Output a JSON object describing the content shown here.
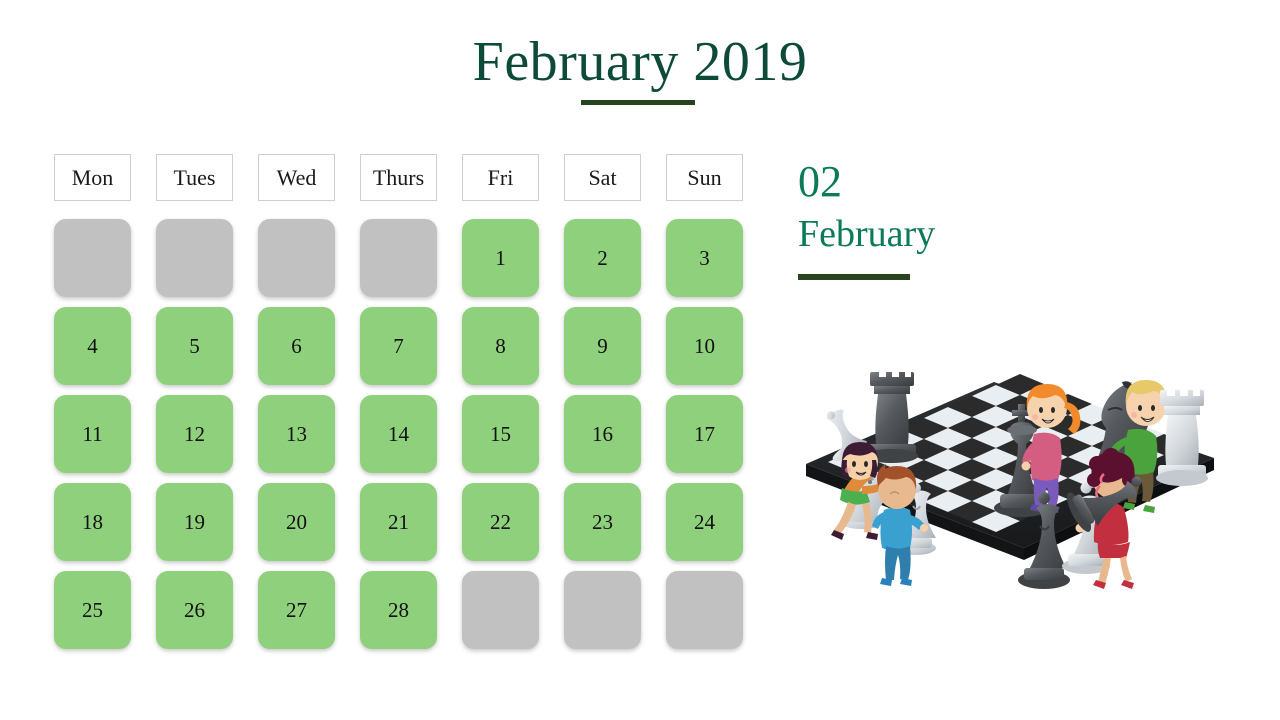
{
  "header": {
    "title": "February 2019",
    "accent_color": "#0d4a3a",
    "underline_color": "#28441f"
  },
  "calendar": {
    "weekdays": [
      "Mon",
      "Tues",
      "Wed",
      "Thurs",
      "Fri",
      "Sat",
      "Sun"
    ],
    "filled_color": "#8fd07c",
    "empty_color": "#c1c1c1",
    "weeks": [
      [
        {
          "label": "",
          "state": "empty"
        },
        {
          "label": "",
          "state": "empty"
        },
        {
          "label": "",
          "state": "empty"
        },
        {
          "label": "",
          "state": "empty"
        },
        {
          "label": "1",
          "state": "filled"
        },
        {
          "label": "2",
          "state": "filled"
        },
        {
          "label": "3",
          "state": "filled"
        }
      ],
      [
        {
          "label": "4",
          "state": "filled"
        },
        {
          "label": "5",
          "state": "filled"
        },
        {
          "label": "6",
          "state": "filled"
        },
        {
          "label": "7",
          "state": "filled"
        },
        {
          "label": "8",
          "state": "filled"
        },
        {
          "label": "9",
          "state": "filled"
        },
        {
          "label": "10",
          "state": "filled"
        }
      ],
      [
        {
          "label": "11",
          "state": "filled"
        },
        {
          "label": "12",
          "state": "filled"
        },
        {
          "label": "13",
          "state": "filled"
        },
        {
          "label": "14",
          "state": "filled"
        },
        {
          "label": "15",
          "state": "filled"
        },
        {
          "label": "16",
          "state": "filled"
        },
        {
          "label": "17",
          "state": "filled"
        }
      ],
      [
        {
          "label": "18",
          "state": "filled"
        },
        {
          "label": "19",
          "state": "filled"
        },
        {
          "label": "20",
          "state": "filled"
        },
        {
          "label": "21",
          "state": "filled"
        },
        {
          "label": "22",
          "state": "filled"
        },
        {
          "label": "23",
          "state": "filled"
        },
        {
          "label": "24",
          "state": "filled"
        }
      ],
      [
        {
          "label": "25",
          "state": "filled"
        },
        {
          "label": "26",
          "state": "filled"
        },
        {
          "label": "27",
          "state": "filled"
        },
        {
          "label": "28",
          "state": "filled"
        },
        {
          "label": "",
          "state": "empty"
        },
        {
          "label": "",
          "state": "empty"
        },
        {
          "label": "",
          "state": "empty"
        }
      ]
    ]
  },
  "side_panel": {
    "month_number": "02",
    "month_name": "February",
    "text_color": "#0b7a58",
    "underline_color": "#28441f"
  },
  "illustration": {
    "name": "children-playing-giant-chess-illustration",
    "board": {
      "light_square_color": "#e9eef2",
      "dark_square_color": "#2b2b2b",
      "edge_color": "#1f1f1f"
    },
    "characters": [
      {
        "name": "girl-dark-bob-orange-top",
        "hair": "#3d1b35",
        "shirt": "#e08a3c",
        "skirt": "#4caf50",
        "holding": "dark-rook"
      },
      {
        "name": "boy-brown-hair-blue-shirt",
        "hair": "#a2522a",
        "shirt": "#3aa0cf",
        "pants": "#2f7fae",
        "holding": "light-bishop"
      },
      {
        "name": "girl-orange-ponytail-pink-top",
        "hair": "#f08a2a",
        "shirt": "#d45e82",
        "pants": "#7a5bbd",
        "holding": "dark-king"
      },
      {
        "name": "boy-blond-green-shirt",
        "hair": "#e8c96a",
        "shirt": "#4aa33c",
        "pants": "#6b5a3a",
        "holding": "dark-knight"
      },
      {
        "name": "girl-curly-red-hair-red-dress",
        "hair": "#5c1030",
        "dress": "#c23040",
        "holding": "light-bishop"
      }
    ],
    "pieces": [
      {
        "name": "dark-rook",
        "tone": "dark"
      },
      {
        "name": "light-rook-standing",
        "tone": "light"
      },
      {
        "name": "light-bishop-fallen-left",
        "tone": "light"
      },
      {
        "name": "light-knight",
        "tone": "light"
      },
      {
        "name": "dark-king",
        "tone": "dark"
      },
      {
        "name": "dark-knight",
        "tone": "dark"
      },
      {
        "name": "dark-bishop",
        "tone": "dark"
      },
      {
        "name": "dark-bishop-fallen-right",
        "tone": "dark"
      },
      {
        "name": "light-bishop",
        "tone": "light"
      }
    ]
  }
}
